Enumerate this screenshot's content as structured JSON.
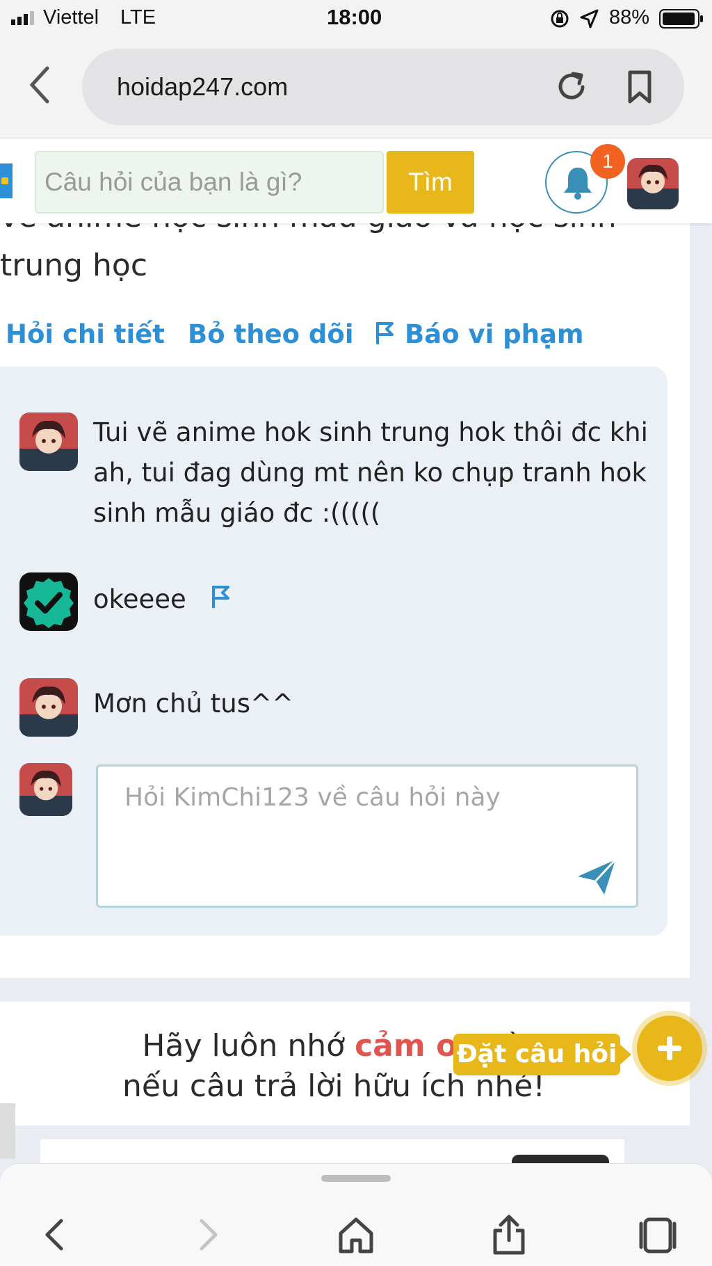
{
  "status_bar": {
    "carrier": "Viettel",
    "network": "LTE",
    "time": "18:00",
    "battery": "88%"
  },
  "browser": {
    "url": "hoidap247.com"
  },
  "site_header": {
    "search_placeholder": "Câu hỏi của bạn là gì?",
    "search_button": "Tìm",
    "notification_count": "1"
  },
  "question": {
    "title_line1": "vẽ anime học sinh mẫu giáo và học sinh",
    "title_line2": "trung học",
    "actions": {
      "ask_detail": "Hỏi chi tiết",
      "unfollow": "Bỏ theo dõi",
      "report": "Báo vi phạm"
    }
  },
  "comments": [
    {
      "text": "Tui vẽ anime hok sinh trung hok thôi đc khi ah, tui đag dùng mt nên ko chụp tranh hok sinh mẫu giáo đc :((((("
    },
    {
      "text": "okeeee"
    },
    {
      "text": "Mơn chủ tus^^"
    }
  ],
  "reply": {
    "placeholder": "Hỏi KimChi123 về câu hỏi này"
  },
  "thanks": {
    "prefix": "Hãy luôn nhớ ",
    "emphasis": "cảm ơn",
    "middle": " và ",
    "line2": "nếu câu trả lời hữu ích nhé!"
  },
  "fab": {
    "label": "Đặt câu hỏi"
  },
  "colors": {
    "accent_blue": "#2d8fd5",
    "brand_yellow": "#e8b81a",
    "badge_orange": "#f26322",
    "emphasis_red": "#e0564f"
  },
  "icons": [
    "signal-icon",
    "rotation-lock-icon",
    "location-arrow-icon",
    "battery-icon",
    "back-chevron-icon",
    "reload-icon",
    "bookmark-icon",
    "bell-icon",
    "flag-icon",
    "checkmark-icon",
    "send-icon",
    "plus-icon",
    "home-icon",
    "share-icon",
    "tabs-icon",
    "forward-chevron-icon"
  ]
}
